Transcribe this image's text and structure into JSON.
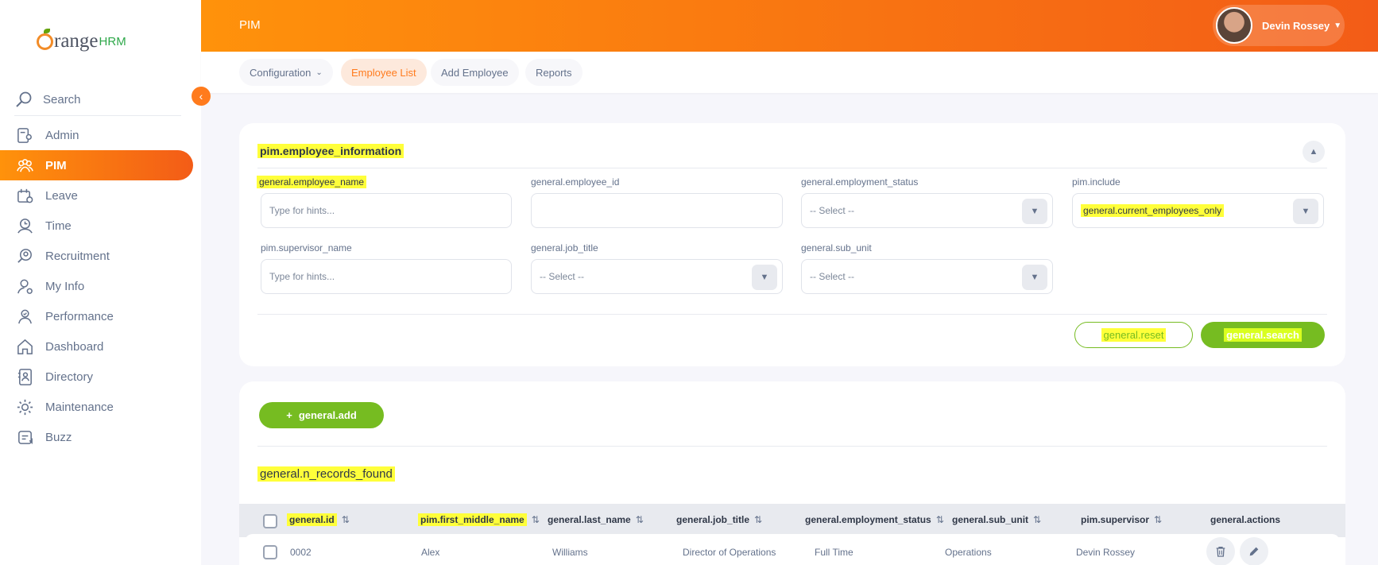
{
  "brand": {
    "name_part1": "range",
    "name_part2": "HRM"
  },
  "sidebar": {
    "search_label": "Search",
    "items": [
      {
        "label": "Admin",
        "icon": "admin-icon"
      },
      {
        "label": "PIM",
        "icon": "pim-icon",
        "active": true
      },
      {
        "label": "Leave",
        "icon": "leave-icon"
      },
      {
        "label": "Time",
        "icon": "time-icon"
      },
      {
        "label": "Recruitment",
        "icon": "recruitment-icon"
      },
      {
        "label": "My Info",
        "icon": "my-info-icon"
      },
      {
        "label": "Performance",
        "icon": "performance-icon"
      },
      {
        "label": "Dashboard",
        "icon": "dashboard-icon"
      },
      {
        "label": "Directory",
        "icon": "directory-icon"
      },
      {
        "label": "Maintenance",
        "icon": "maintenance-icon"
      },
      {
        "label": "Buzz",
        "icon": "buzz-icon"
      }
    ]
  },
  "header": {
    "title": "PIM",
    "user_name": "Devin Rossey"
  },
  "tabs": [
    {
      "label": "Configuration"
    },
    {
      "label": "Employee List"
    },
    {
      "label": "Add Employee"
    },
    {
      "label": "Reports"
    }
  ],
  "filter": {
    "title": "pim.employee_information",
    "fields": {
      "employee_name": {
        "label": "general.employee_name",
        "placeholder": "Type for hints..."
      },
      "employee_id": {
        "label": "general.employee_id",
        "value": ""
      },
      "employment_status": {
        "label": "general.employment_status",
        "value": "-- Select --"
      },
      "include": {
        "label": "pim.include",
        "value": "general.current_employees_only"
      },
      "supervisor_name": {
        "label": "pim.supervisor_name",
        "placeholder": "Type for hints..."
      },
      "job_title": {
        "label": "general.job_title",
        "value": "-- Select --"
      },
      "sub_unit": {
        "label": "general.sub_unit",
        "value": "-- Select --"
      }
    },
    "reset_label": "general.reset",
    "search_label": "general.search"
  },
  "list": {
    "add_label": "general.add",
    "add_prefix": "+",
    "records_found": "general.n_records_found",
    "columns": [
      "general.id",
      "pim.first_middle_name",
      "general.last_name",
      "general.job_title",
      "general.employment_status",
      "general.sub_unit",
      "pim.supervisor",
      "general.actions"
    ],
    "rows": [
      {
        "id": "0002",
        "first_middle_name": "Alex",
        "last_name": "Williams",
        "job_title": "Director of Operations",
        "employment_status": "Full Time",
        "sub_unit": "Operations",
        "supervisor": "Devin Rossey"
      }
    ]
  },
  "colors": {
    "accent": "#ff7b1d",
    "green": "#76bc21",
    "highlight": "#ffff3a"
  }
}
